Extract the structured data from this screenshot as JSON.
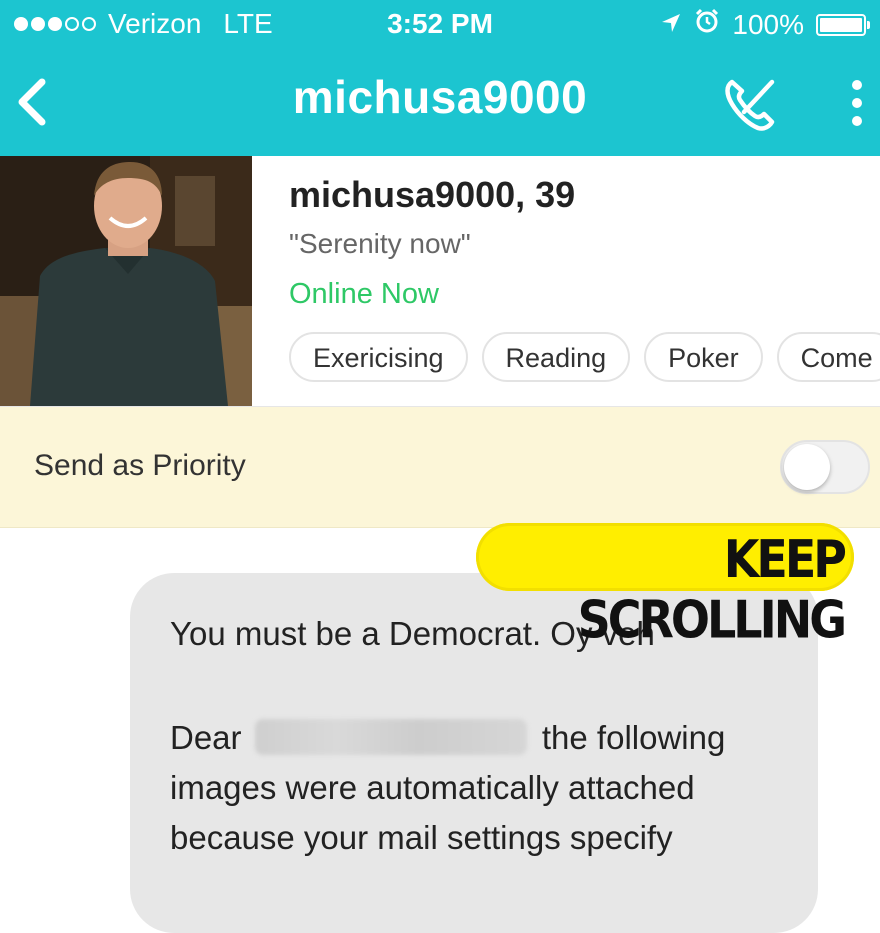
{
  "status_bar": {
    "carrier": "Verizon",
    "network": "LTE",
    "time": "3:52 PM",
    "battery": "100%",
    "battery_level": 1.0,
    "signal_bars_filled": 3,
    "signal_bars_total": 5
  },
  "nav": {
    "title": "michusa9000",
    "back_icon": "chevron-left-icon",
    "call_icon": "phone-off-icon",
    "more_icon": "more-vertical-icon"
  },
  "profile": {
    "name_age": "michusa9000, 39",
    "quote": "\"Serenity now\"",
    "status": "Online Now",
    "tags": [
      "Exericising",
      "Reading",
      "Poker",
      "Come"
    ]
  },
  "priority": {
    "label": "Send as Priority",
    "toggle_on": false
  },
  "banner": {
    "text": "KEEP SCROLLING"
  },
  "message": {
    "line1": "You must be a Democrat.  Oy veh",
    "line2_prefix": "Dear",
    "line2_suffix": "the following",
    "line3": "images were automatically attached",
    "line4": "because your mail settings specify"
  },
  "colors": {
    "accent": "#1cc5d0",
    "online": "#2ec866",
    "priority_bg": "#fcf6d8",
    "banner": "#ffee00",
    "bubble": "#e7e7e7"
  }
}
